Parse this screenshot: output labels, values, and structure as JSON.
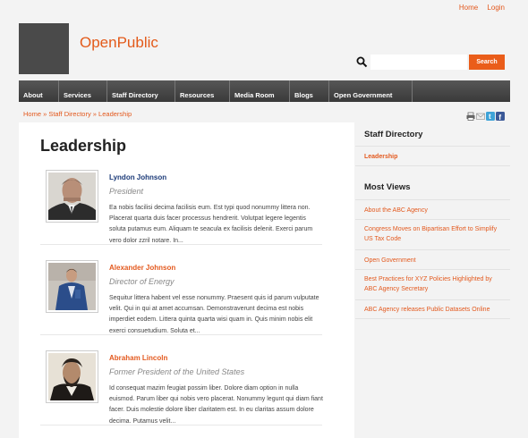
{
  "top_links": {
    "home": "Home",
    "login": "Login"
  },
  "site": {
    "name": "OpenPublic"
  },
  "search": {
    "placeholder": "",
    "button_label": "Search"
  },
  "nav": [
    "About",
    "Services",
    "Staff Directory",
    "Resources",
    "Media Room",
    "Blogs",
    "Open Government"
  ],
  "breadcrumb": "Home » Staff Directory » Leadership",
  "page": {
    "title": "Leadership"
  },
  "people": [
    {
      "name": "Lyndon Johnson",
      "role": "President",
      "bio": "Ea nobis facilisi decima facilisis eum. Est typi quod nonummy littera non. Placerat quarta duis facer processus hendrerit. Volutpat legere legentis soluta putamus eum. Aliquam te seacula ex facilisis delenit. Exerci parum vero dolor zzril notare. In..."
    },
    {
      "name": "Alexander Johnson",
      "role": "Director of Energy",
      "bio": "Sequitur littera habent vel esse nonummy. Praesent quis id parum vulputate velit. Qui in qui at amet accumsan. Demonstraverunt decima est nobis imperdiet eodem. Littera quinta quarta wisi quam in. Quis minim nobis elit exerci consuetudium. Soluta et..."
    },
    {
      "name": "Abraham Lincoln",
      "role": "Former President of the United States",
      "bio": "Id consequat mazim feugiat possim liber. Dolore diam option in nulla euismod. Parum liber qui nobis vero placerat. Nonummy legunt qui diam fiant facer. Duis molestie dolore liber claritatem est. In eu claritas assum dolore decima. Putamus velit..."
    }
  ],
  "sidebar": {
    "staff_title": "Staff Directory",
    "staff_link": "Leadership",
    "most_views_title": "Most Views",
    "most_views": [
      "About the ABC Agency",
      "Congress Moves on Bipartisan Effort to Simplify US Tax Code",
      "Open Government",
      "Best Practices for XYZ Policies Highlighted by ABC Agency Secretary",
      "ABC Agency releases Public Datasets Online"
    ]
  },
  "colors": {
    "accent": "#e3591e",
    "nav_bg": "#474747",
    "name_blue": "#1b3a78"
  }
}
